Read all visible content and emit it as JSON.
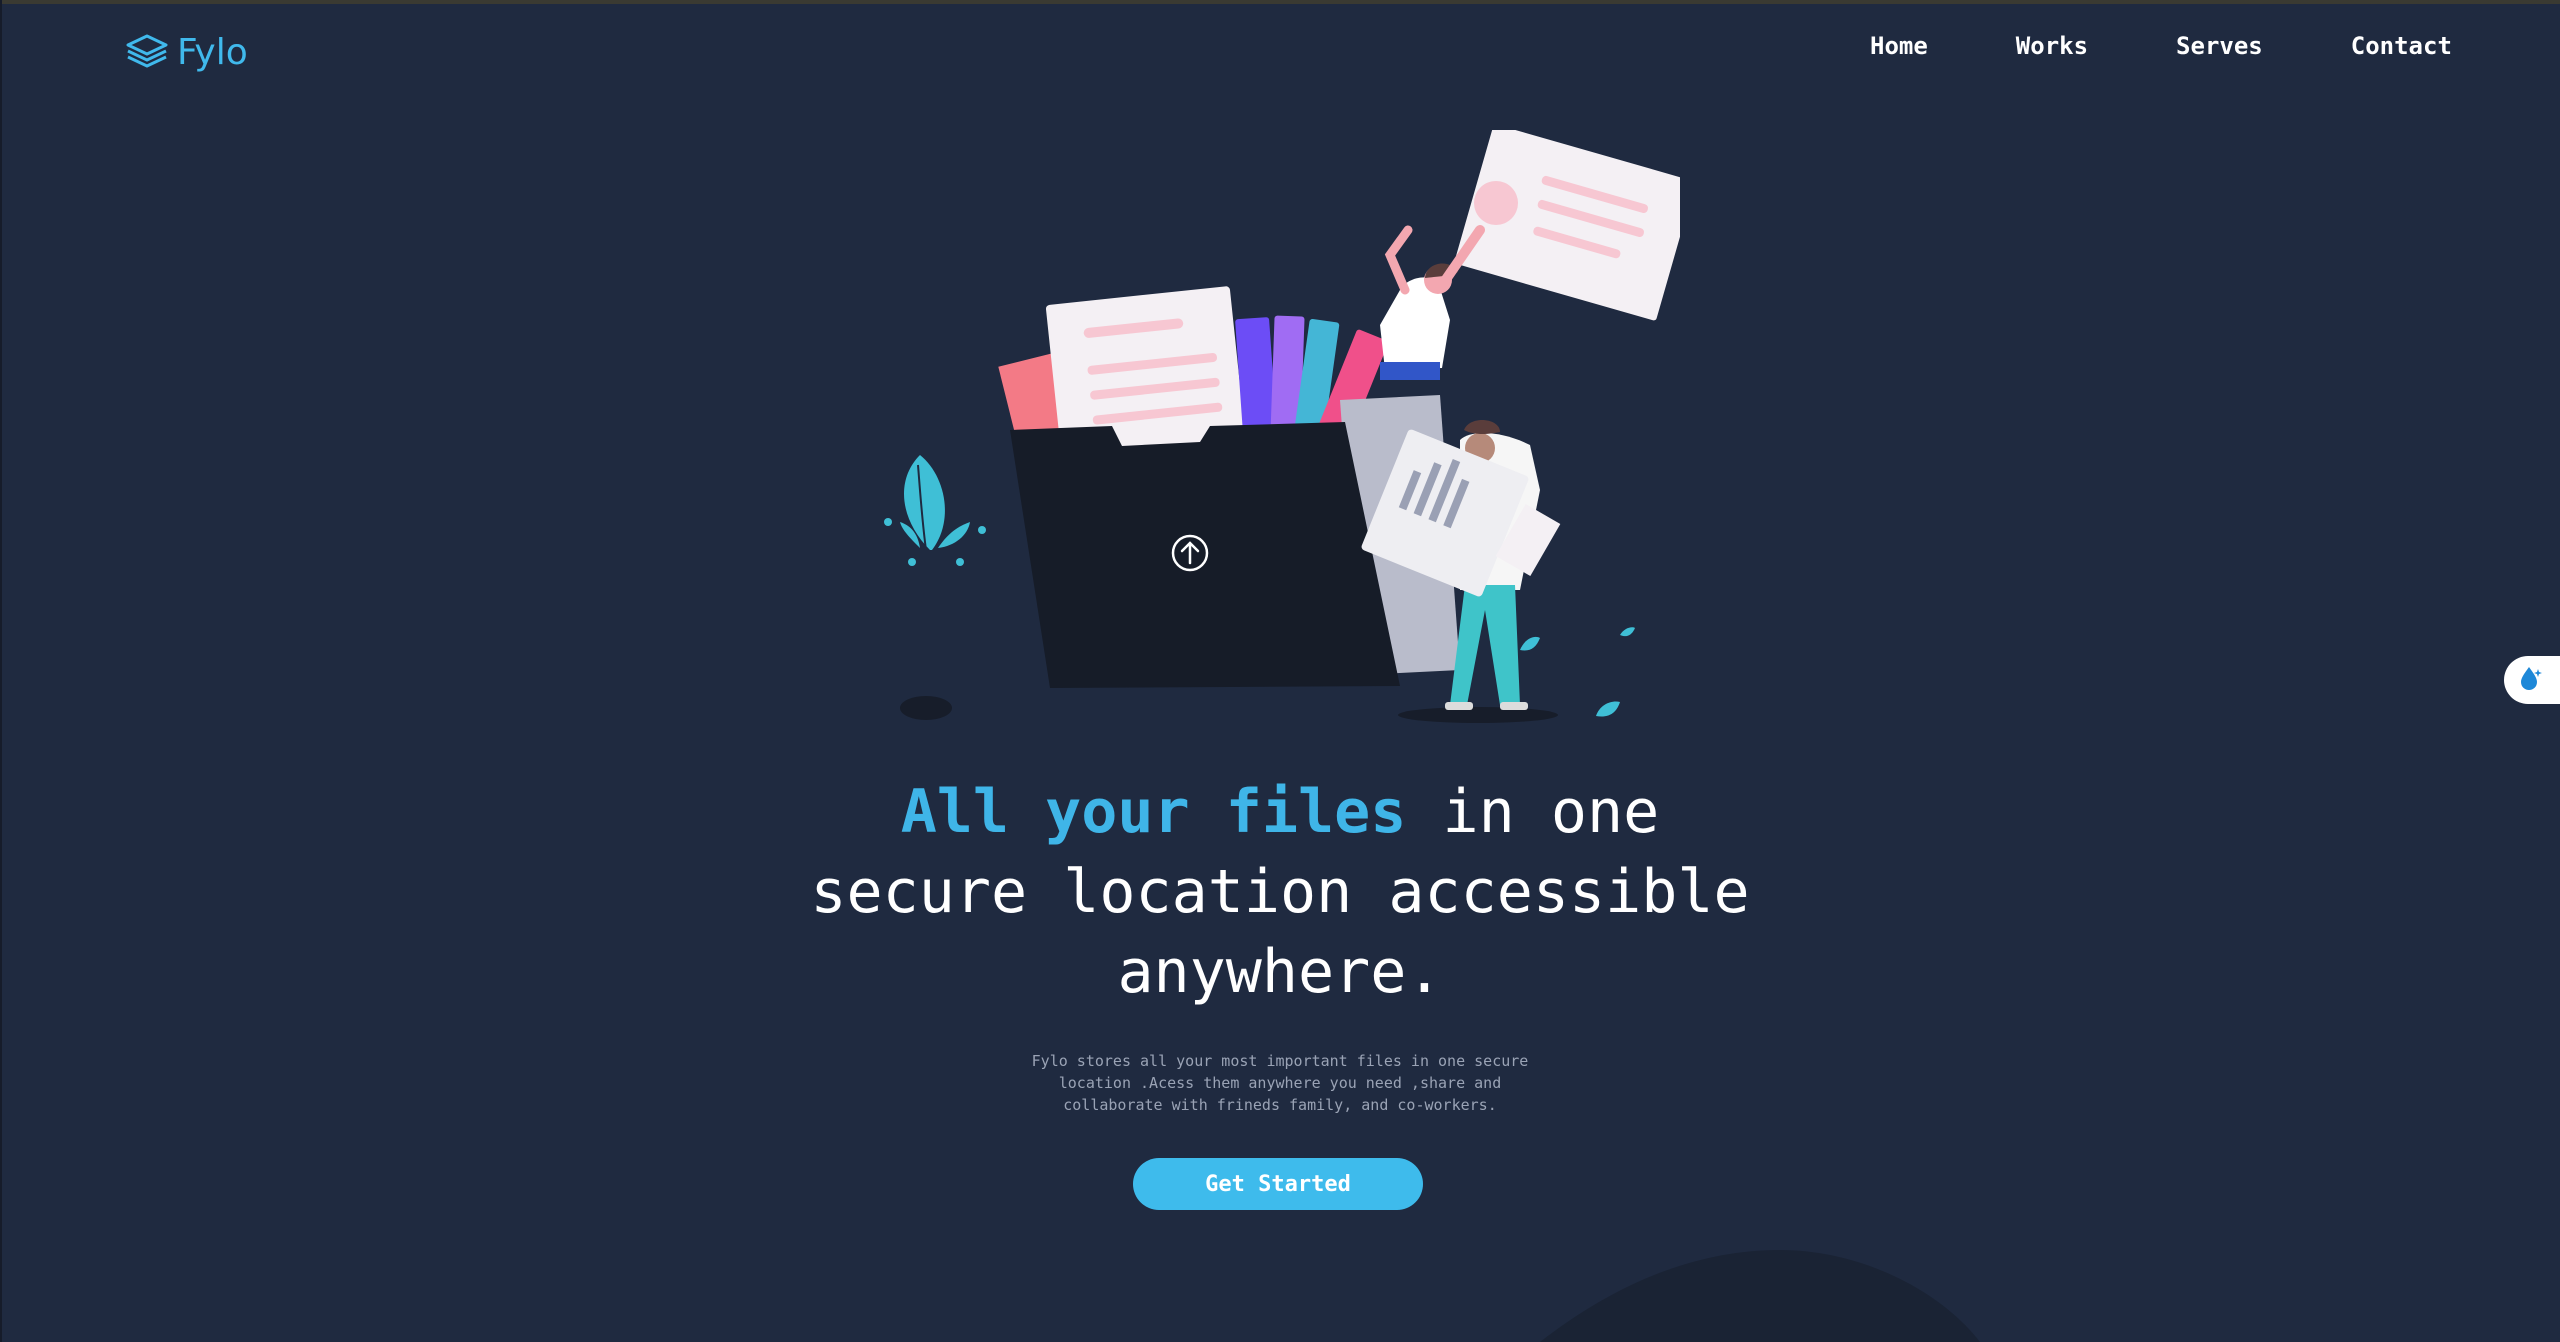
{
  "brand": {
    "name": "Fylo",
    "icon": "layers-icon",
    "color": "#40b9ec"
  },
  "nav": [
    {
      "label": "Home"
    },
    {
      "label": "Works"
    },
    {
      "label": "Serves"
    },
    {
      "label": "Contact"
    }
  ],
  "hero": {
    "headline_accent": "All your files",
    "headline_rest": " in one secure location accessible anywhere.",
    "description": "Fylo stores all your most important files in one secure location .Acess them anywhere you need ,share and collaborate with frineds family, and co-workers.",
    "cta_label": "Get Started",
    "illustration_icon": "upload-arrow-icon"
  },
  "side_widget": {
    "icon": "dark-mode-drop-icon"
  },
  "colors": {
    "background": "#1f2a40",
    "accent": "#3fb5e8",
    "button": "#3ebbec",
    "text": "#ffffff",
    "muted": "#9aa3b5"
  }
}
